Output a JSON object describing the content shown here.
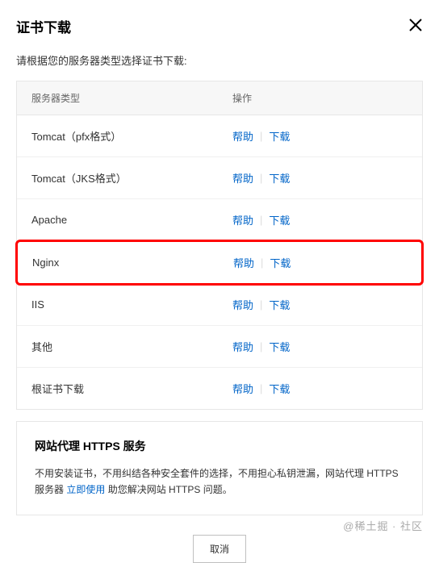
{
  "header": {
    "title": "证书下载"
  },
  "subtitle": "请根据您的服务器类型选择证书下载:",
  "table": {
    "columns": {
      "type": "服务器类型",
      "action": "操作"
    },
    "rows": [
      {
        "type": "Tomcat（pfx格式）",
        "help": "帮助",
        "download": "下载",
        "highlight": false
      },
      {
        "type": "Tomcat（JKS格式）",
        "help": "帮助",
        "download": "下载",
        "highlight": false
      },
      {
        "type": "Apache",
        "help": "帮助",
        "download": "下载",
        "highlight": false
      },
      {
        "type": "Nginx",
        "help": "帮助",
        "download": "下载",
        "highlight": true
      },
      {
        "type": "IIS",
        "help": "帮助",
        "download": "下载",
        "highlight": false
      },
      {
        "type": "其他",
        "help": "帮助",
        "download": "下载",
        "highlight": false
      },
      {
        "type": "根证书下载",
        "help": "帮助",
        "download": "下载",
        "highlight": false
      }
    ]
  },
  "info": {
    "title": "网站代理 HTTPS 服务",
    "text_before": "不用安装证书，不用纠结各种安全套件的选择，不用担心私钥泄漏，网站代理 HTTPS 服务器 ",
    "link": "立即使用",
    "text_after": " 助您解决网站 HTTPS 问题。"
  },
  "footer": {
    "cancel": "取消"
  },
  "watermark": "@稀土掘    · 社区"
}
